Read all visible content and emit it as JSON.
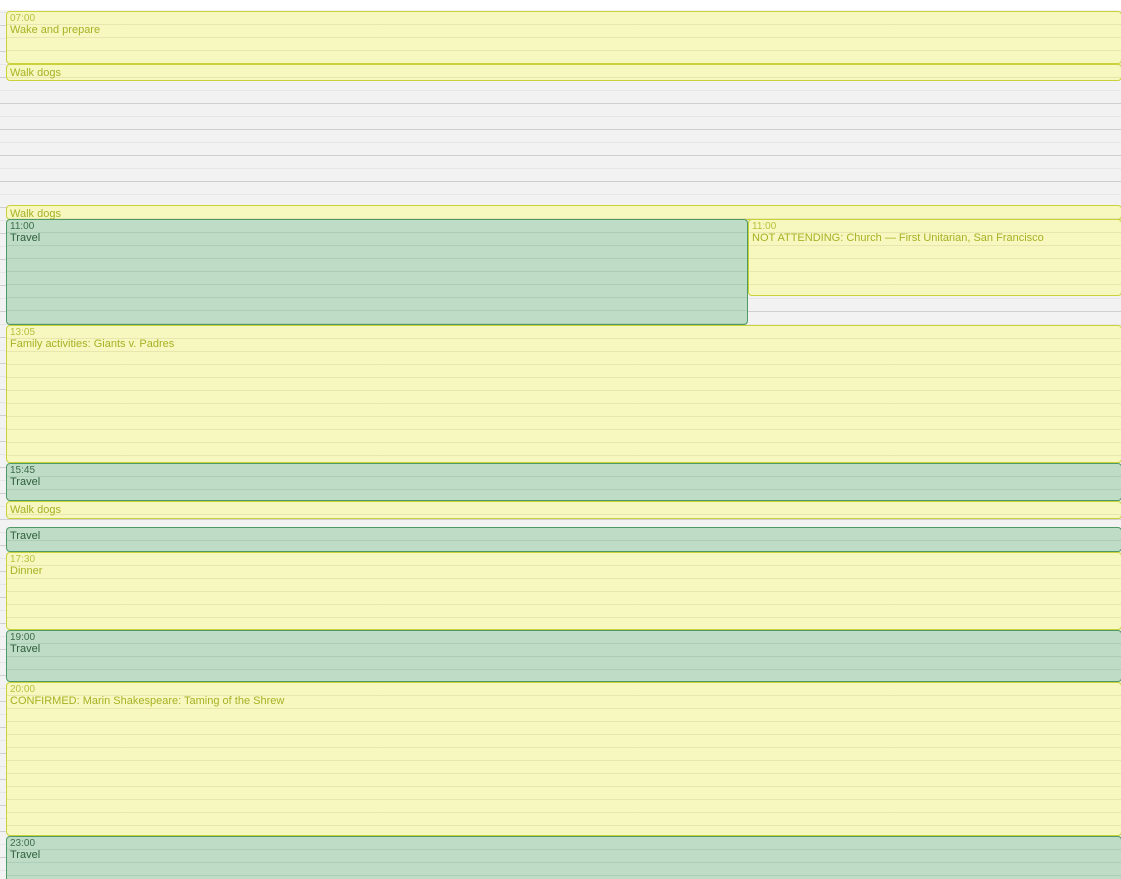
{
  "calendar": {
    "colors": {
      "personal_bg": "#f7f8c0",
      "personal_border": "#c9d23a",
      "personal_text": "#a7b124",
      "travel_bg": "#bfdcc6",
      "travel_border": "#4f9a64",
      "travel_text": "#2c5e3b",
      "grid_bg": "#f2f2f2"
    },
    "events": [
      {
        "time": "07:00",
        "title": "Wake and prepare",
        "calendar": "personal"
      },
      {
        "time": "",
        "title": "Walk dogs",
        "calendar": "personal"
      },
      {
        "time": "",
        "title": "Walk dogs",
        "calendar": "personal"
      },
      {
        "time": "11:00",
        "title": "Travel",
        "calendar": "travel"
      },
      {
        "time": "11:00",
        "title": "NOT ATTENDING: Church — First Unitarian, San Francisco",
        "calendar": "personal"
      },
      {
        "time": "13:05",
        "title": "Family activities: Giants v. Padres",
        "calendar": "personal"
      },
      {
        "time": "15:45",
        "title": "Travel",
        "calendar": "travel"
      },
      {
        "time": "",
        "title": "Walk dogs",
        "calendar": "personal"
      },
      {
        "time": "",
        "title": "Travel",
        "calendar": "travel"
      },
      {
        "time": "17:30",
        "title": "Dinner",
        "calendar": "personal"
      },
      {
        "time": "19:00",
        "title": "Travel",
        "calendar": "travel"
      },
      {
        "time": "20:00",
        "title": "CONFIRMED: Marin Shakespeare: Taming of the Shrew",
        "calendar": "personal"
      },
      {
        "time": "23:00",
        "title": "Travel",
        "calendar": "travel"
      }
    ]
  }
}
